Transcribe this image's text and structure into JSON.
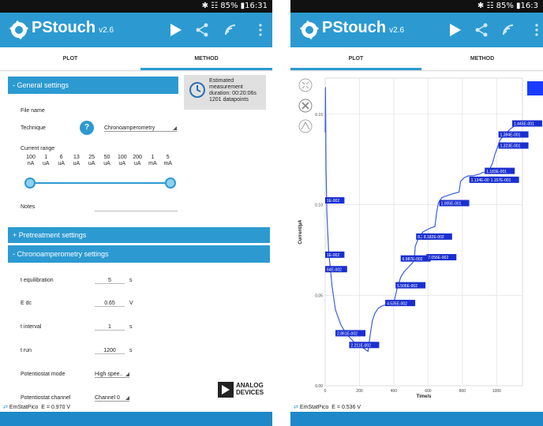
{
  "left": {
    "status": {
      "text": "✱ ☷ 85% ▮16:31"
    },
    "app": {
      "title": "PStouch",
      "version": "v2.6"
    },
    "tabs": {
      "plot": "PLOT",
      "method": "METHOD"
    },
    "general_header": "- General settings",
    "estimate": {
      "line1": "Estimated",
      "line2": "measurement",
      "line3": "duration: 00:20:06s",
      "line4": "1201 datapoints"
    },
    "file_name_label": "File name",
    "technique": {
      "label": "Technique",
      "help": "?",
      "value": "Chronoamperometry"
    },
    "current_range": {
      "label": "Current range",
      "values": [
        "100",
        "1",
        "6",
        "13",
        "25",
        "50",
        "100",
        "200",
        "1",
        "5"
      ],
      "units": [
        "nA",
        "uA",
        "uA",
        "uA",
        "uA",
        "uA",
        "uA",
        "uA",
        "mA",
        "mA"
      ]
    },
    "notes_label": "Notes",
    "pretreatment_header": "+ Pretreatment settings",
    "chrono_header": "- Chronoamperometry settings",
    "params": [
      {
        "label": "t equilibration",
        "value": "5",
        "unit": "s"
      },
      {
        "label": "E dc",
        "value": "0.65",
        "unit": "V"
      },
      {
        "label": "t interval",
        "value": "1",
        "unit": "s"
      },
      {
        "label": "t run",
        "value": "1200",
        "unit": "s"
      }
    ],
    "pot_mode": {
      "label": "Potentiostat mode",
      "value": "High spee.."
    },
    "pot_channel": {
      "label": "Potentiostat channel",
      "value": "Channel 0"
    },
    "brand": {
      "line1": "ANALOG",
      "line2": "DEVICES"
    },
    "device_line": {
      "prefix": "EmStatPico",
      "text": "E = 0.970 V"
    }
  },
  "right": {
    "status": {
      "text": "✱ ☷ 85% ▮16:3"
    },
    "app": {
      "title": "PStouch",
      "version": "v2.6"
    },
    "tabs": {
      "plot": "PLOT",
      "method": "METHOD"
    },
    "device_line": {
      "prefix": "EmStatPico",
      "text": "E = 0.536 V"
    },
    "accent": "#1a3cff"
  },
  "chart_data": {
    "type": "line",
    "xlabel": "Time/s",
    "ylabel": "Current/µA",
    "xlim": [
      0,
      1150
    ],
    "ylim": [
      0,
      0.17
    ],
    "xticks": [
      "0",
      "200",
      "400",
      "600",
      "800",
      "1000"
    ],
    "yticks": [
      "0.00",
      "0.05",
      "0.10",
      "0.15"
    ],
    "series": [
      {
        "color": "#3a5fe0",
        "x": [
          0,
          2,
          5,
          10,
          20,
          40,
          60,
          90,
          120,
          150,
          180,
          220,
          250,
          262,
          275,
          290,
          310,
          330,
          360,
          400,
          420,
          440,
          460,
          490,
          510,
          520,
          525,
          545,
          570,
          610,
          640,
          650,
          660,
          680,
          710,
          740,
          780,
          790,
          810,
          835,
          860,
          900,
          920,
          950,
          975,
          990,
          1005,
          1020,
          1040,
          1060,
          1080,
          1110,
          1150
        ],
        "y": [
          0.14,
          0.165,
          0.12,
          0.095,
          0.075,
          0.055,
          0.042,
          0.034,
          0.029,
          0.026,
          0.023,
          0.021,
          0.019,
          0.028,
          0.036,
          0.04,
          0.043,
          0.044,
          0.045,
          0.046,
          0.054,
          0.06,
          0.063,
          0.066,
          0.068,
          0.07,
          0.077,
          0.082,
          0.085,
          0.087,
          0.088,
          0.096,
          0.101,
          0.104,
          0.105,
          0.106,
          0.107,
          0.113,
          0.115,
          0.116,
          0.116,
          0.117,
          0.118,
          0.118,
          0.123,
          0.128,
          0.132,
          0.136,
          0.138,
          0.14,
          0.142,
          0.144,
          0.145
        ]
      }
    ],
    "annotations": [
      {
        "text": "1E-002",
        "x": 0,
        "y": 0.102
      },
      {
        "text": "1E-002",
        "x": 0,
        "y": 0.072
      },
      {
        "text": "64E-002",
        "x": 0,
        "y": 0.064
      },
      {
        "text": "2.861E-002",
        "x": 60,
        "y": 0.0286
      },
      {
        "text": "2.211E-002",
        "x": 140,
        "y": 0.0221
      },
      {
        "text": "4.535E-002",
        "x": 350,
        "y": 0.0453
      },
      {
        "text": "5.506E-002",
        "x": 410,
        "y": 0.0551
      },
      {
        "text": "6.987E-002",
        "x": 440,
        "y": 0.0699
      },
      {
        "text": "8.21",
        "x": 530,
        "y": 0.082
      },
      {
        "text": "8.182E-002",
        "x": 565,
        "y": 0.082
      },
      {
        "text": "7.056E-002",
        "x": 590,
        "y": 0.0706
      },
      {
        "text": "1.005E-001",
        "x": 665,
        "y": 0.1005
      },
      {
        "text": "1.134E-001",
        "x": 840,
        "y": 0.1134
      },
      {
        "text": "1.157E-001",
        "x": 955,
        "y": 0.1134
      },
      {
        "text": "1.183E-001",
        "x": 930,
        "y": 0.1183
      },
      {
        "text": "1.323E-001",
        "x": 1010,
        "y": 0.1323
      },
      {
        "text": "1.384E-001",
        "x": 1010,
        "y": 0.1384
      },
      {
        "text": "1.445E-001",
        "x": 1090,
        "y": 0.1445
      }
    ]
  }
}
